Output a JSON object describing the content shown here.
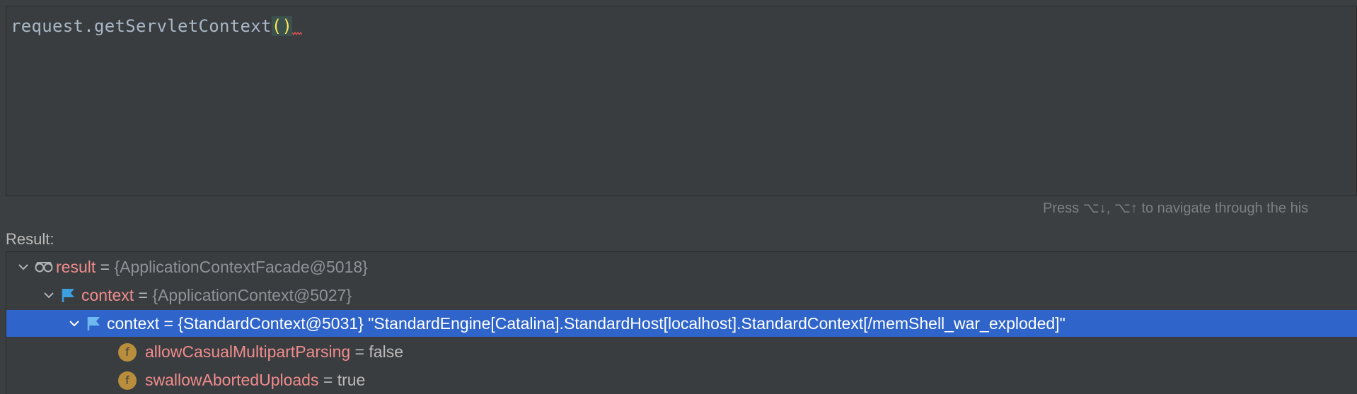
{
  "editor": {
    "code_prefix": "request.getServletContext",
    "code_parens": "()"
  },
  "hint": {
    "text": "Press ⌥↓, ⌥↑ to navigate through the his"
  },
  "result_label": "Result:",
  "tree": {
    "rows": [
      {
        "name": "result",
        "eq": " = ",
        "value": "{ApplicationContextFacade@5018}",
        "icon": "watch-glasses-icon",
        "expanded": true
      },
      {
        "name": "context",
        "eq": " = ",
        "value": "{ApplicationContext@5027}",
        "icon": "flag-icon",
        "expanded": true
      },
      {
        "name": "context",
        "eq": " = ",
        "value": "{StandardContext@5031} \"StandardEngine[Catalina].StandardHost[localhost].StandardContext[/memShell_war_exploded]\"",
        "icon": "flag-icon",
        "expanded": true,
        "selected": true
      },
      {
        "name": "allowCasualMultipartParsing",
        "eq": " = ",
        "value": "false",
        "icon": "field-icon",
        "icon_letter": "f"
      },
      {
        "name": "swallowAbortedUploads",
        "eq": " = ",
        "value": "true",
        "icon": "field-icon",
        "icon_letter": "f"
      }
    ]
  },
  "colors": {
    "background": "#3c3f41",
    "selection": "#2f65ca",
    "name": "#f08c8c",
    "paren_highlight": "#ffe357",
    "field_icon": "#b88d3c",
    "flag_icon": "#3c9fe0"
  }
}
